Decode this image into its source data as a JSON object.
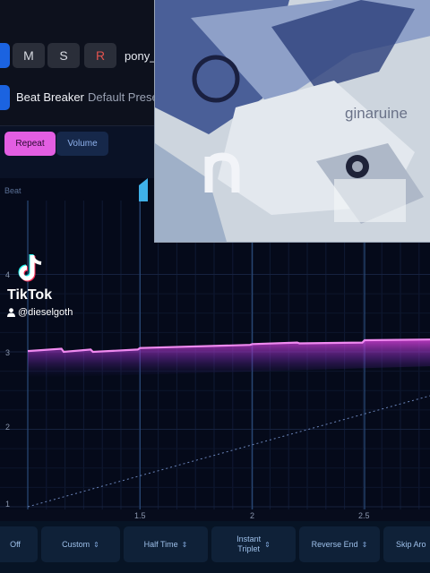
{
  "track": {
    "mute_label": "M",
    "solo_label": "S",
    "record_label": "R",
    "name": "pony_"
  },
  "plugin": {
    "name": "Beat Breaker",
    "preset": "Default Prese"
  },
  "modes": {
    "repeat": "Repeat",
    "volume": "Volume"
  },
  "graph": {
    "beat_label": "Beat",
    "y_ticks": [
      "4",
      "3",
      "2",
      "1"
    ],
    "x_ticks": [
      "1.5",
      "2",
      "2.5"
    ]
  },
  "overlay": {
    "tiktok_name": "TikTok",
    "tiktok_user": "@dieselgoth",
    "video_text": "ginaruine"
  },
  "bottom": {
    "off": "Off",
    "custom": "Custom",
    "half_time": "Half Time",
    "instant_triplet_1": "Instant",
    "instant_triplet_2": "Triplet",
    "reverse_end": "Reverse End",
    "skip": "Skip Aro"
  },
  "colors": {
    "accent_pink": "#e35ee2",
    "accent_blue": "#1b63e0",
    "record_red": "#e2534f"
  },
  "chart_data": {
    "type": "line",
    "xlabel": "",
    "ylabel": "Beat",
    "xlim": [
      1.0,
      2.8
    ],
    "ylim": [
      1,
      4.2
    ],
    "series": [
      {
        "x": [
          1.0,
          1.15,
          1.16,
          1.28,
          1.29,
          1.49,
          1.5,
          1.99,
          2.0,
          2.2,
          2.21,
          2.49,
          2.5,
          2.8
        ],
        "y": [
          3.01,
          3.04,
          3.0,
          3.03,
          3.0,
          3.03,
          3.05,
          3.09,
          3.1,
          3.12,
          3.11,
          3.12,
          3.15,
          3.16
        ]
      },
      {
        "x": [
          1.0,
          2.8
        ],
        "y": [
          1.0,
          2.8
        ]
      }
    ],
    "grid": true
  }
}
